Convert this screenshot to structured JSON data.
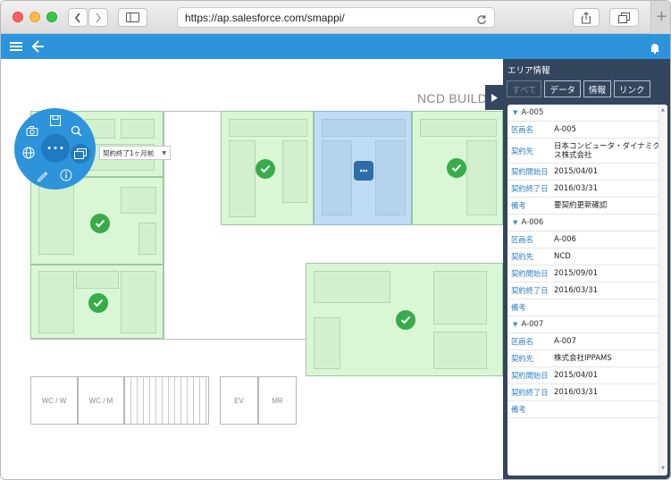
{
  "browser": {
    "url": "https://ap.salesforce.com/smappi/"
  },
  "map": {
    "building_label": "NCD BUILD",
    "filter_select_value": "契約終了1ヶ月前",
    "fixtures": [
      "WC / W",
      "WC / M",
      "EV",
      "MR"
    ],
    "radial_center": "• • •"
  },
  "panel": {
    "title": "エリア情報",
    "tabs": [
      "すべて",
      "データ",
      "情報",
      "リンク"
    ],
    "areas": [
      {
        "id": "A-005",
        "rows": [
          {
            "key": "区画名",
            "value": "A-005"
          },
          {
            "key": "契約先",
            "value": "日本コンピュータ・ダイナミクス株式会社"
          },
          {
            "key": "契約開始日",
            "value": "2015/04/01"
          },
          {
            "key": "契約終了日",
            "value": "2016/03/31"
          },
          {
            "key": "備考",
            "value": "要契約更新確認"
          }
        ]
      },
      {
        "id": "A-006",
        "rows": [
          {
            "key": "区画名",
            "value": "A-006"
          },
          {
            "key": "契約先",
            "value": "NCD"
          },
          {
            "key": "契約開始日",
            "value": "2015/09/01"
          },
          {
            "key": "契約終了日",
            "value": "2016/03/31"
          },
          {
            "key": "備考",
            "value": ""
          }
        ]
      },
      {
        "id": "A-007",
        "rows": [
          {
            "key": "区画名",
            "value": "A-007"
          },
          {
            "key": "契約先",
            "value": "株式会社IPPAMS"
          },
          {
            "key": "契約開始日",
            "value": "2015/04/01"
          },
          {
            "key": "契約終了日",
            "value": "2016/03/31"
          },
          {
            "key": "備考",
            "value": ""
          }
        ]
      }
    ]
  },
  "colors": {
    "app_header": "#2d94db",
    "panel_bg": "#33465d",
    "room_green": "#d9f7d4",
    "room_selected": "#bfdcf6",
    "check": "#38ab4b"
  }
}
